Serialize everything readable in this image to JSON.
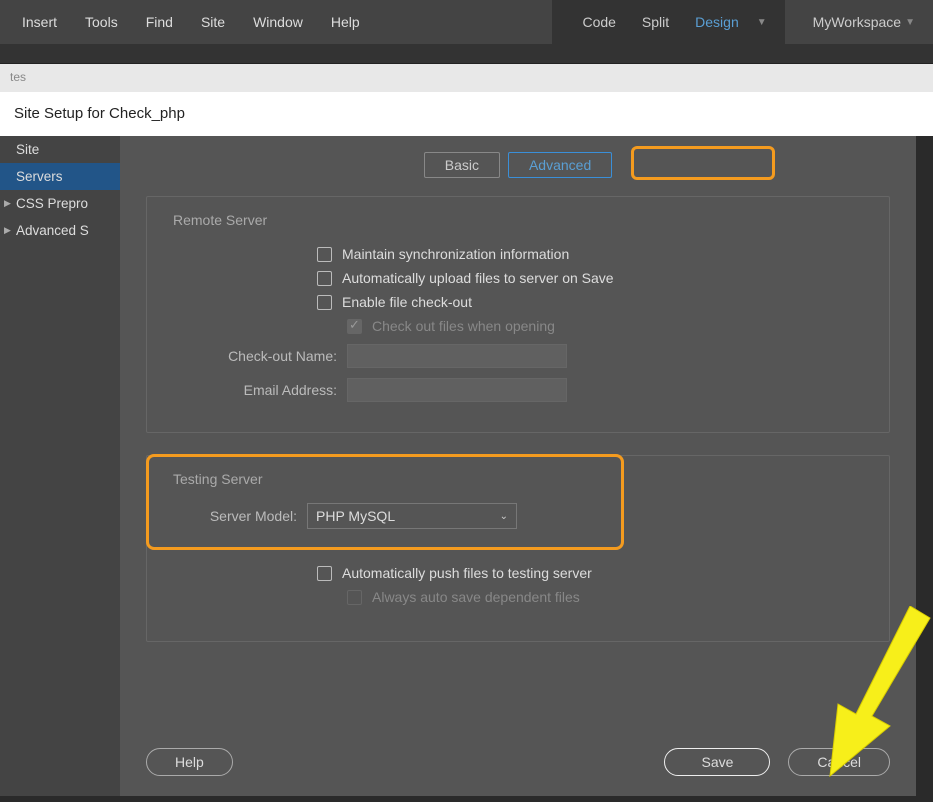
{
  "menubar": {
    "items": [
      "Insert",
      "Tools",
      "Find",
      "Site",
      "Window",
      "Help"
    ],
    "views": {
      "code": "Code",
      "split": "Split",
      "design": "Design"
    },
    "workspace": "MyWorkspace"
  },
  "tabstrip": {
    "visible": "tes"
  },
  "dialog": {
    "title": "Site Setup for Check_php",
    "sidebar": {
      "items": [
        {
          "label": "Site",
          "expandable": false
        },
        {
          "label": "Servers",
          "expandable": false,
          "selected": true
        },
        {
          "label": "CSS Prepro",
          "expandable": true
        },
        {
          "label": "Advanced S",
          "expandable": true
        }
      ]
    },
    "tabs": {
      "basic": "Basic",
      "advanced": "Advanced"
    },
    "remote": {
      "legend": "Remote Server",
      "maintain": "Maintain synchronization information",
      "autoupload": "Automatically upload files to server on Save",
      "enablecheckout": "Enable file check-out",
      "checkoutopen": "Check out files when opening",
      "checkoutname_label": "Check-out Name:",
      "email_label": "Email Address:"
    },
    "testing": {
      "legend": "Testing Server",
      "servermodel_label": "Server Model:",
      "servermodel_value": "PHP MySQL",
      "autopush": "Automatically push files to testing server",
      "autosavedep": "Always auto save dependent files"
    },
    "buttons": {
      "help": "Help",
      "save": "Save",
      "cancel": "Cancel"
    }
  }
}
